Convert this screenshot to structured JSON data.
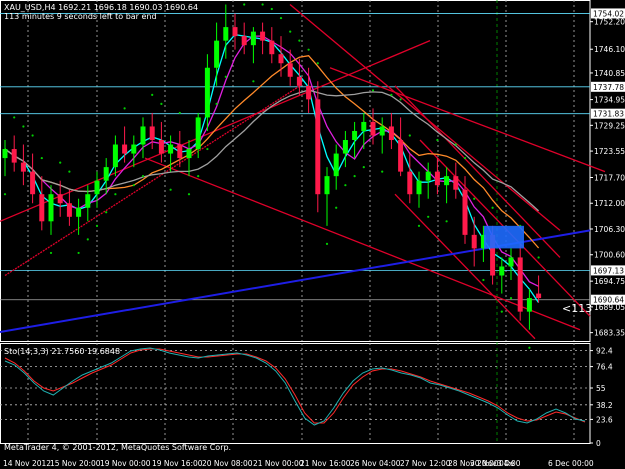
{
  "header": {
    "title_line": "XAU_USD,H4  1692.21 1696.18 1690.03 1690.64",
    "timer_line": "113 minutes 9 seconds left to bar end"
  },
  "subwindow": {
    "title": "Sto(14,3,3) 21.7560 19.6848"
  },
  "footer": {
    "copyright": "MetaTrader 4, © 2001-2012, MetaQuotes Software Corp."
  },
  "colors": {
    "background": "#000000",
    "bull_candle": "#00ff00",
    "bear_candle": "#ff1a4b",
    "trendline_red": "#e0002a",
    "trendline_blue": "#1e1ee6",
    "ma_cyan": "#00ffff",
    "ma_magenta": "#e020e0",
    "ma_gray": "#a0a0a0",
    "ma_orange": "#ff8a2a",
    "sar_green": "#00d000",
    "hline_cyan": "#60e0ff",
    "stoch_main": "#20b0b0",
    "stoch_signal": "#ff2a2a",
    "price_tag_bg": "#2080c0"
  },
  "chart_data": {
    "type": "candlestick",
    "symbol": "XAU_USD",
    "timeframe": "H4",
    "price_axis": {
      "range": [
        1681.5,
        1757.0
      ],
      "ticks": [
        "1752.20",
        "1746.10",
        "1740.85",
        "1734.95",
        "1729.25",
        "1723.55",
        "1717.70",
        "1712.00",
        "1706.30",
        "1700.60",
        "1694.75",
        "1689.05",
        "1683.35"
      ]
    },
    "time_axis": {
      "labels": [
        "14 Nov 2012",
        "15 Nov 20:00",
        "19 Nov 00:00",
        "19 Nov 16:00",
        "20 Nov 08:00",
        "21 Nov 00:00",
        "21 Nov 16:00",
        "26 Nov 04:00",
        "27 Nov 12:00",
        "28 Nov 20:00",
        "30 Nov 04:00",
        "3 De",
        "6 Dec 00:00"
      ]
    },
    "price_tags": [
      {
        "value": "1754.02"
      },
      {
        "value": "1737.78"
      },
      {
        "value": "1731.83"
      },
      {
        "value": "1697.13"
      },
      {
        "value": "1690.64"
      }
    ],
    "countdown_label": "<113",
    "candles": [
      [
        1722,
        1726,
        1718,
        1724
      ],
      [
        1724,
        1727,
        1719,
        1721
      ],
      [
        1721,
        1725,
        1716,
        1719
      ],
      [
        1719,
        1723,
        1712,
        1714
      ],
      [
        1714,
        1718,
        1706,
        1708
      ],
      [
        1708,
        1716,
        1705,
        1714
      ],
      [
        1714,
        1717,
        1709,
        1712
      ],
      [
        1712,
        1715,
        1707,
        1709
      ],
      [
        1709,
        1713,
        1705,
        1711
      ],
      [
        1711,
        1716,
        1708,
        1714
      ],
      [
        1714,
        1719,
        1711,
        1717
      ],
      [
        1717,
        1722,
        1714,
        1720
      ],
      [
        1720,
        1727,
        1718,
        1725
      ],
      [
        1725,
        1729,
        1721,
        1723
      ],
      [
        1723,
        1727,
        1720,
        1725
      ],
      [
        1725,
        1731,
        1722,
        1729
      ],
      [
        1729,
        1732,
        1724,
        1726
      ],
      [
        1726,
        1730,
        1721,
        1723
      ],
      [
        1723,
        1727,
        1719,
        1725
      ],
      [
        1725,
        1728,
        1720,
        1722
      ],
      [
        1722,
        1726,
        1718,
        1724
      ],
      [
        1724,
        1732,
        1722,
        1731
      ],
      [
        1731,
        1745,
        1728,
        1742
      ],
      [
        1742,
        1752,
        1738,
        1748
      ],
      [
        1748,
        1756,
        1744,
        1751
      ],
      [
        1751,
        1754,
        1746,
        1749
      ],
      [
        1749,
        1752,
        1745,
        1747
      ],
      [
        1747,
        1751,
        1743,
        1750
      ],
      [
        1750,
        1752,
        1745,
        1748
      ],
      [
        1748,
        1751,
        1743,
        1745
      ],
      [
        1745,
        1749,
        1740,
        1743
      ],
      [
        1743,
        1746,
        1738,
        1740
      ],
      [
        1740,
        1744,
        1736,
        1738
      ],
      [
        1738,
        1742,
        1732,
        1735
      ],
      [
        1735,
        1739,
        1710,
        1714
      ],
      [
        1714,
        1720,
        1707,
        1718
      ],
      [
        1718,
        1725,
        1715,
        1723
      ],
      [
        1723,
        1728,
        1720,
        1726
      ],
      [
        1726,
        1730,
        1722,
        1728
      ],
      [
        1728,
        1732,
        1724,
        1730
      ],
      [
        1730,
        1733,
        1725,
        1727
      ],
      [
        1727,
        1731,
        1723,
        1729
      ],
      [
        1729,
        1732,
        1724,
        1726
      ],
      [
        1726,
        1731,
        1718,
        1719
      ],
      [
        1719,
        1723,
        1712,
        1714
      ],
      [
        1714,
        1719,
        1711,
        1717
      ],
      [
        1717,
        1721,
        1713,
        1719
      ],
      [
        1719,
        1722,
        1714,
        1716
      ],
      [
        1716,
        1720,
        1712,
        1718
      ],
      [
        1718,
        1721,
        1713,
        1715
      ],
      [
        1715,
        1718,
        1703,
        1705
      ],
      [
        1705,
        1709,
        1698,
        1702
      ],
      [
        1702,
        1707,
        1699,
        1705
      ],
      [
        1705,
        1707,
        1694,
        1696
      ],
      [
        1696,
        1700,
        1692,
        1698
      ],
      [
        1698,
        1702,
        1695,
        1700
      ],
      [
        1700,
        1703,
        1686,
        1688
      ],
      [
        1688,
        1693,
        1684,
        1691
      ],
      [
        1692,
        1696,
        1690,
        1691
      ]
    ],
    "stochastic": {
      "name": "Sto(14,3,3)",
      "main_value": 21.756,
      "signal_value": 19.6848,
      "levels": [
        92.4,
        76.4,
        55,
        38.2,
        23.6,
        0
      ],
      "main": [
        82,
        78,
        70,
        60,
        52,
        48,
        55,
        62,
        68,
        72,
        76,
        80,
        86,
        92,
        94,
        95,
        93,
        90,
        88,
        86,
        85,
        87,
        88,
        89,
        90,
        88,
        85,
        80,
        72,
        60,
        42,
        25,
        18,
        22,
        35,
        50,
        62,
        70,
        74,
        75,
        73,
        70,
        68,
        65,
        60,
        58,
        55,
        52,
        48,
        44,
        40,
        35,
        28,
        22,
        20,
        24,
        30,
        34,
        30,
        24,
        22
      ],
      "signal": [
        85,
        80,
        72,
        62,
        55,
        52,
        56,
        60,
        65,
        70,
        74,
        78,
        84,
        90,
        93,
        94,
        94,
        92,
        90,
        88,
        86,
        86,
        87,
        88,
        89,
        89,
        86,
        82,
        75,
        64,
        48,
        30,
        20,
        20,
        30,
        45,
        58,
        66,
        72,
        74,
        74,
        72,
        69,
        66,
        62,
        59,
        56,
        53,
        50,
        46,
        42,
        37,
        30,
        25,
        22,
        23,
        27,
        31,
        29,
        25,
        21
      ]
    }
  }
}
